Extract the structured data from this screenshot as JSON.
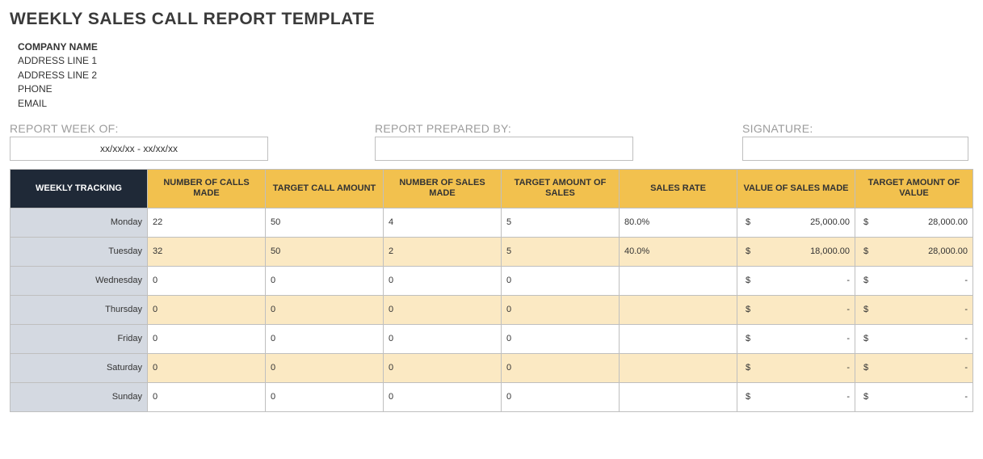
{
  "title": "WEEKLY SALES CALL REPORT TEMPLATE",
  "company": {
    "name": "COMPANY NAME",
    "address1": "ADDRESS LINE 1",
    "address2": "ADDRESS LINE 2",
    "phone": "PHONE",
    "email": "EMAIL"
  },
  "meta": {
    "week_of_label": "REPORT WEEK OF:",
    "week_of_value": "xx/xx/xx - xx/xx/xx",
    "prepared_by_label": "REPORT PREPARED BY:",
    "prepared_by_value": "",
    "signature_label": "SIGNATURE:",
    "signature_value": ""
  },
  "table": {
    "headers": {
      "tracking": "WEEKLY TRACKING",
      "calls_made": "NUMBER OF CALLS MADE",
      "target_calls": "TARGET CALL AMOUNT",
      "sales_made": "NUMBER OF SALES MADE",
      "target_sales": "TARGET AMOUNT OF SALES",
      "sales_rate": "SALES RATE",
      "value_sales": "VALUE OF SALES MADE",
      "target_value": "TARGET AMOUNT OF VALUE"
    },
    "currency_symbol": "$",
    "rows": [
      {
        "day": "Monday",
        "calls_made": "22",
        "target_calls": "50",
        "sales_made": "4",
        "target_sales": "5",
        "sales_rate": "80.0%",
        "value_sales": "25,000.00",
        "target_value": "28,000.00"
      },
      {
        "day": "Tuesday",
        "calls_made": "32",
        "target_calls": "50",
        "sales_made": "2",
        "target_sales": "5",
        "sales_rate": "40.0%",
        "value_sales": "18,000.00",
        "target_value": "28,000.00"
      },
      {
        "day": "Wednesday",
        "calls_made": "0",
        "target_calls": "0",
        "sales_made": "0",
        "target_sales": "0",
        "sales_rate": "",
        "value_sales": "-",
        "target_value": "-"
      },
      {
        "day": "Thursday",
        "calls_made": "0",
        "target_calls": "0",
        "sales_made": "0",
        "target_sales": "0",
        "sales_rate": "",
        "value_sales": "-",
        "target_value": "-"
      },
      {
        "day": "Friday",
        "calls_made": "0",
        "target_calls": "0",
        "sales_made": "0",
        "target_sales": "0",
        "sales_rate": "",
        "value_sales": "-",
        "target_value": "-"
      },
      {
        "day": "Saturday",
        "calls_made": "0",
        "target_calls": "0",
        "sales_made": "0",
        "target_sales": "0",
        "sales_rate": "",
        "value_sales": "-",
        "target_value": "-"
      },
      {
        "day": "Sunday",
        "calls_made": "0",
        "target_calls": "0",
        "sales_made": "0",
        "target_sales": "0",
        "sales_rate": "",
        "value_sales": "-",
        "target_value": "-"
      }
    ]
  }
}
